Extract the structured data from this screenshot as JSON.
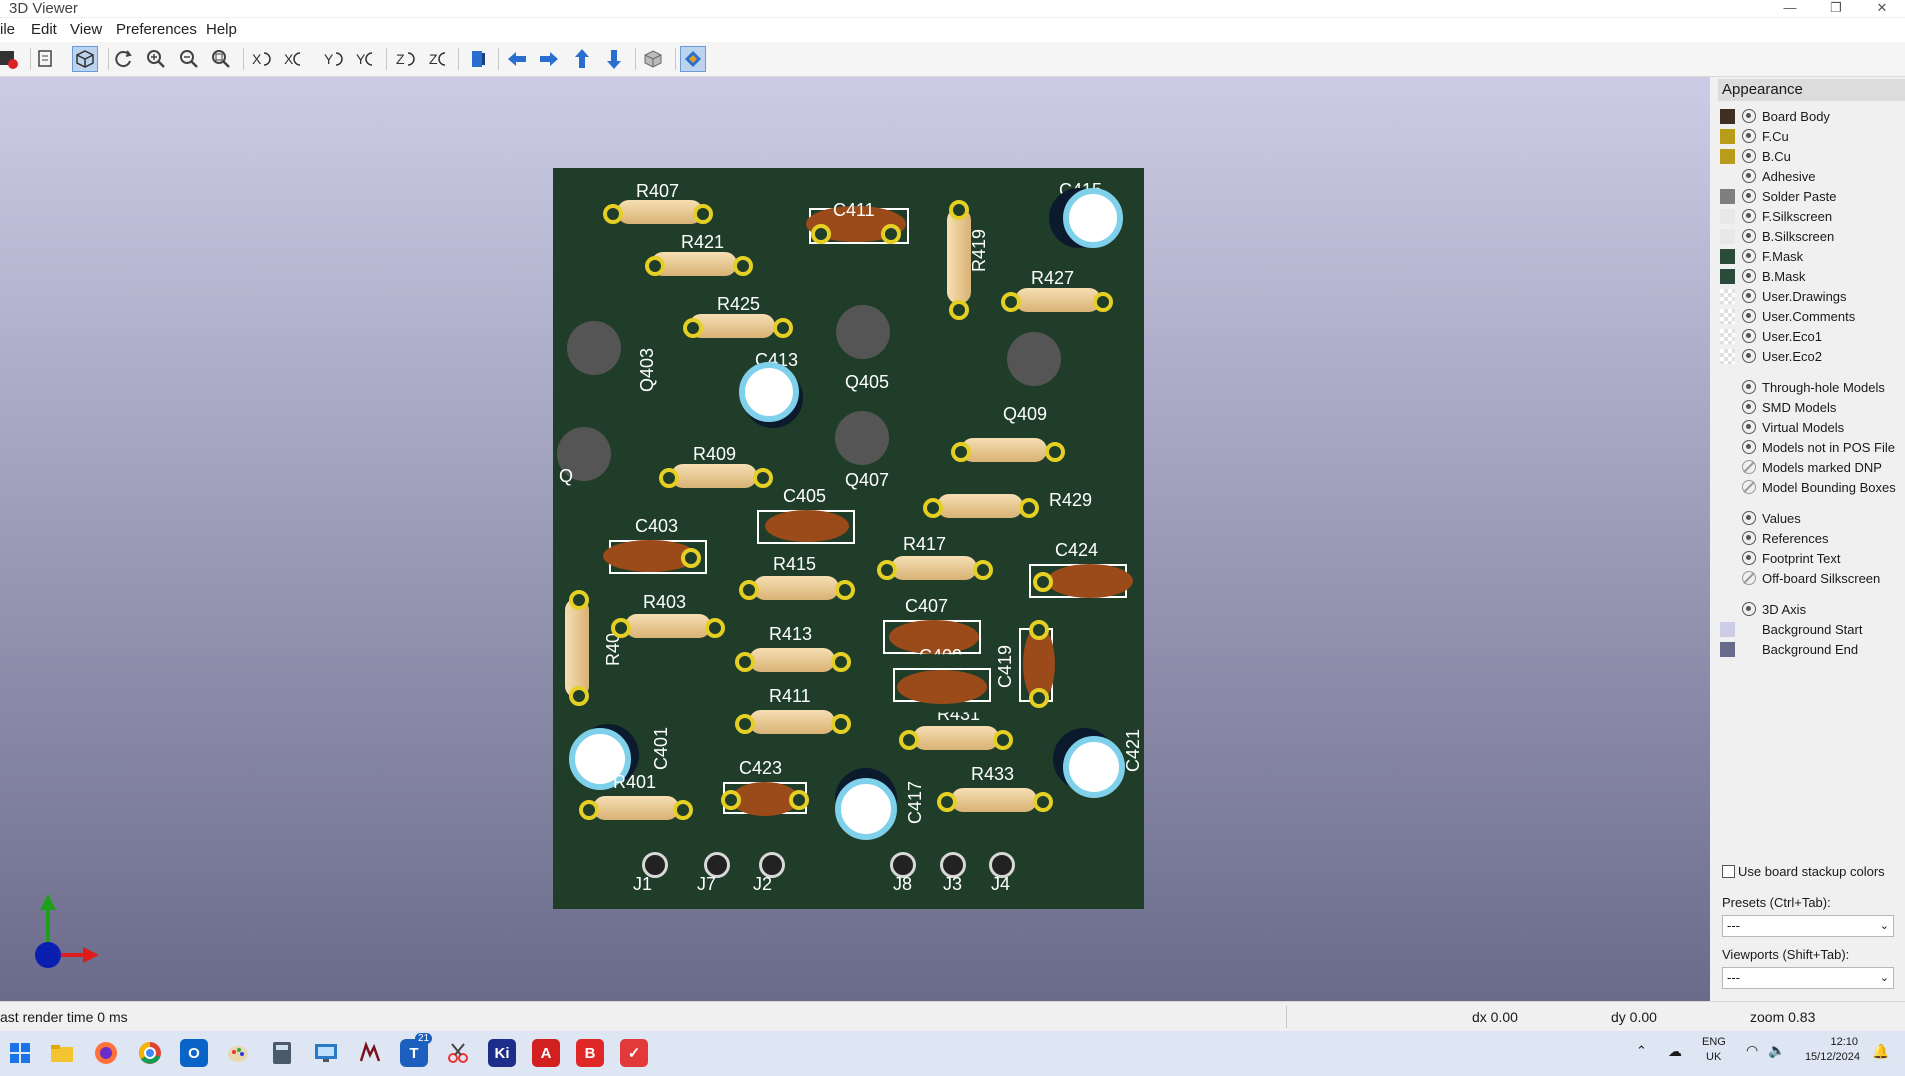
{
  "window": {
    "title": "3D Viewer",
    "controls": [
      "—",
      "❐",
      "✕"
    ]
  },
  "menu": [
    "ile",
    "Edit",
    "View",
    "Preferences",
    "Help"
  ],
  "toolbar": [
    {
      "name": "render-raytraced-icon"
    },
    {
      "name": "copy-clipboard-icon"
    },
    {
      "name": "render-opengl-icon",
      "active": true
    },
    {
      "name": "reload-board-icon"
    },
    {
      "name": "zoom-in-icon"
    },
    {
      "name": "zoom-out-icon"
    },
    {
      "name": "zoom-fit-icon"
    },
    {
      "name": "rotate-x-cw-icon"
    },
    {
      "name": "rotate-x-ccw-icon"
    },
    {
      "name": "rotate-y-cw-icon"
    },
    {
      "name": "rotate-y-ccw-icon"
    },
    {
      "name": "rotate-z-cw-icon"
    },
    {
      "name": "rotate-z-ccw-icon"
    },
    {
      "name": "flip-board-icon"
    },
    {
      "name": "move-left-icon"
    },
    {
      "name": "move-right-icon"
    },
    {
      "name": "move-up-icon"
    },
    {
      "name": "move-down-icon"
    },
    {
      "name": "ortho-toggle-icon"
    },
    {
      "name": "layers-manager-icon",
      "active": true
    }
  ],
  "board": {
    "references": {
      "R407": "R407",
      "C411": "C411",
      "C415": "C415",
      "R421": "R421",
      "R419": "R419",
      "R427": "R427",
      "R425": "R425",
      "C413": "C413",
      "Q403": "Q403",
      "Q405": "Q405",
      "Q409": "Q409",
      "Q401": "Q",
      "R409": "R409",
      "Q407": "Q407",
      "C405": "C405",
      "R429": "R429",
      "C403": "C403",
      "R417": "R417",
      "R415": "R415",
      "C424": "C424",
      "R403": "R403",
      "C407": "C407",
      "R405": "R40",
      "R413": "R413",
      "C409": "C409",
      "C419": "C419",
      "R411": "R411",
      "R431": "R431",
      "C401": "C401",
      "C423": "C423",
      "R433": "R433",
      "C421": "C421",
      "R401": "R401",
      "C417": "C417",
      "J1": "J1",
      "J7": "J7",
      "J2": "J2",
      "J8": "J8",
      "J3": "J3",
      "J4": "J4"
    }
  },
  "appearance": {
    "title": "Appearance",
    "layers": [
      {
        "name": "Board Body",
        "color": "#3f2f22",
        "visible": true
      },
      {
        "name": "F.Cu",
        "color": "#b89c1a",
        "visible": true
      },
      {
        "name": "B.Cu",
        "color": "#b89c1a",
        "visible": true
      },
      {
        "name": "Adhesive",
        "color": "",
        "visible": true
      },
      {
        "name": "Solder Paste",
        "color": "#7f7f7f",
        "visible": true
      },
      {
        "name": "F.Silkscreen",
        "color": "#e8e8e8",
        "visible": true
      },
      {
        "name": "B.Silkscreen",
        "color": "#e8e8e8",
        "visible": true
      },
      {
        "name": "F.Mask",
        "color": "#2a4a3a",
        "visible": true
      },
      {
        "name": "B.Mask",
        "color": "#2a4a3a",
        "visible": true
      },
      {
        "name": "User.Drawings",
        "color": "checker",
        "visible": true
      },
      {
        "name": "User.Comments",
        "color": "checker",
        "visible": true
      },
      {
        "name": "User.Eco1",
        "color": "checker",
        "visible": true
      },
      {
        "name": "User.Eco2",
        "color": "checker",
        "visible": true
      }
    ],
    "models": [
      {
        "name": "Through-hole Models",
        "visible": true
      },
      {
        "name": "SMD Models",
        "visible": true
      },
      {
        "name": "Virtual Models",
        "visible": true
      },
      {
        "name": "Models not in POS File",
        "visible": true
      },
      {
        "name": "Models marked DNP",
        "visible": false
      },
      {
        "name": "Model Bounding Boxes",
        "visible": false
      }
    ],
    "text": [
      {
        "name": "Values",
        "visible": true
      },
      {
        "name": "References",
        "visible": true
      },
      {
        "name": "Footprint Text",
        "visible": true
      },
      {
        "name": "Off-board Silkscreen",
        "visible": false
      }
    ],
    "misc": [
      {
        "name": "3D Axis",
        "visible": true,
        "color": ""
      },
      {
        "name": "Background Start",
        "visible": null,
        "color": "#cccce6"
      },
      {
        "name": "Background End",
        "visible": null,
        "color": "#6a6a8a"
      }
    ],
    "stackup_checkbox": "Use board stackup colors",
    "presets_label": "Presets (Ctrl+Tab):",
    "presets_value": "---",
    "viewports_label": "Viewports (Shift+Tab):",
    "viewports_value": "---"
  },
  "status": {
    "render": "ast render time 0 ms",
    "dx": "dx 0.00",
    "dy": "dy 0.00",
    "zoom": "zoom 0.83"
  },
  "taskbar": {
    "lang": "ENG",
    "region": "UK",
    "time": "12:10",
    "date": "15/12/2024",
    "badge": "21"
  }
}
